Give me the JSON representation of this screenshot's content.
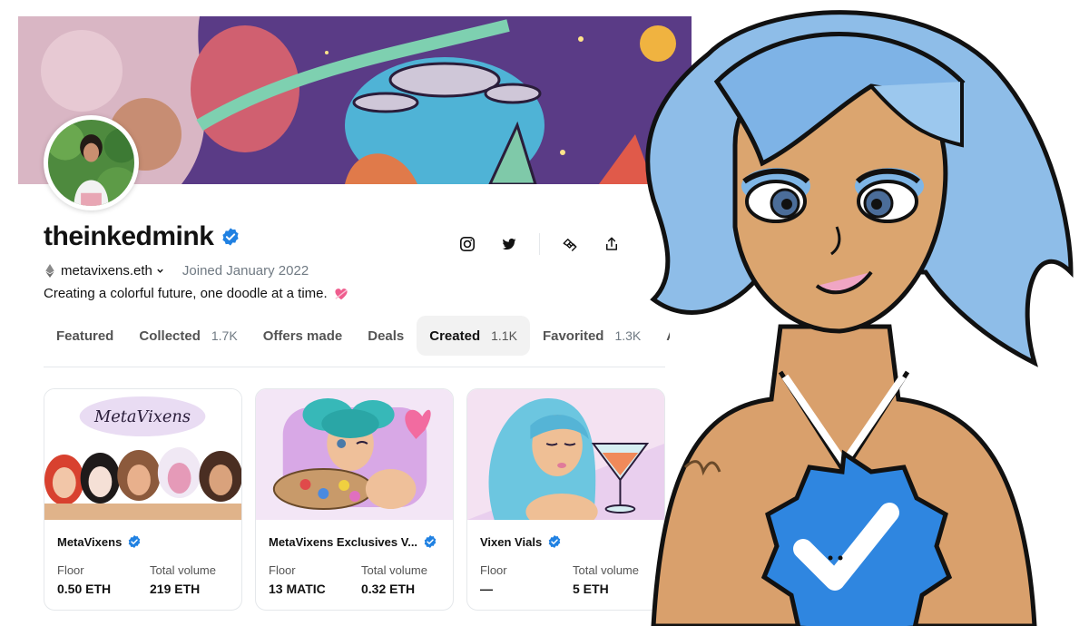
{
  "profile": {
    "username": "theinkedmink",
    "wallet": "metavixens.eth",
    "joined": "Joined January 2022",
    "bio": "Creating a colorful future, one doodle at a time."
  },
  "actions": [
    "instagram-icon",
    "twitter-icon",
    "offer-icon",
    "share-icon"
  ],
  "tabs": [
    {
      "label": "Featured",
      "count": ""
    },
    {
      "label": "Collected",
      "count": "1.7K"
    },
    {
      "label": "Offers made",
      "count": ""
    },
    {
      "label": "Deals",
      "count": ""
    },
    {
      "label": "Created",
      "count": "1.1K"
    },
    {
      "label": "Favorited",
      "count": "1.3K"
    },
    {
      "label": "A",
      "count": ""
    }
  ],
  "active_tab": "Created",
  "cards": [
    {
      "title": "MetaVixens",
      "floor_label": "Floor",
      "floor": "0.50 ETH",
      "volume_label": "Total volume",
      "volume": "219 ETH",
      "image_text": "MetaVixens"
    },
    {
      "title": "MetaVixens Exclusives V...",
      "floor_label": "Floor",
      "floor": "13 MATIC",
      "volume_label": "Total volume",
      "volume": "0.32 ETH"
    },
    {
      "title": "Vixen Vials",
      "floor_label": "Floor",
      "floor": "—",
      "volume_label": "Total volume",
      "volume": "5 ETH"
    }
  ],
  "colors": {
    "verified": "#2081e2",
    "text": "#121212",
    "muted": "#707a83",
    "active_tab_bg": "#f2f2f2"
  }
}
